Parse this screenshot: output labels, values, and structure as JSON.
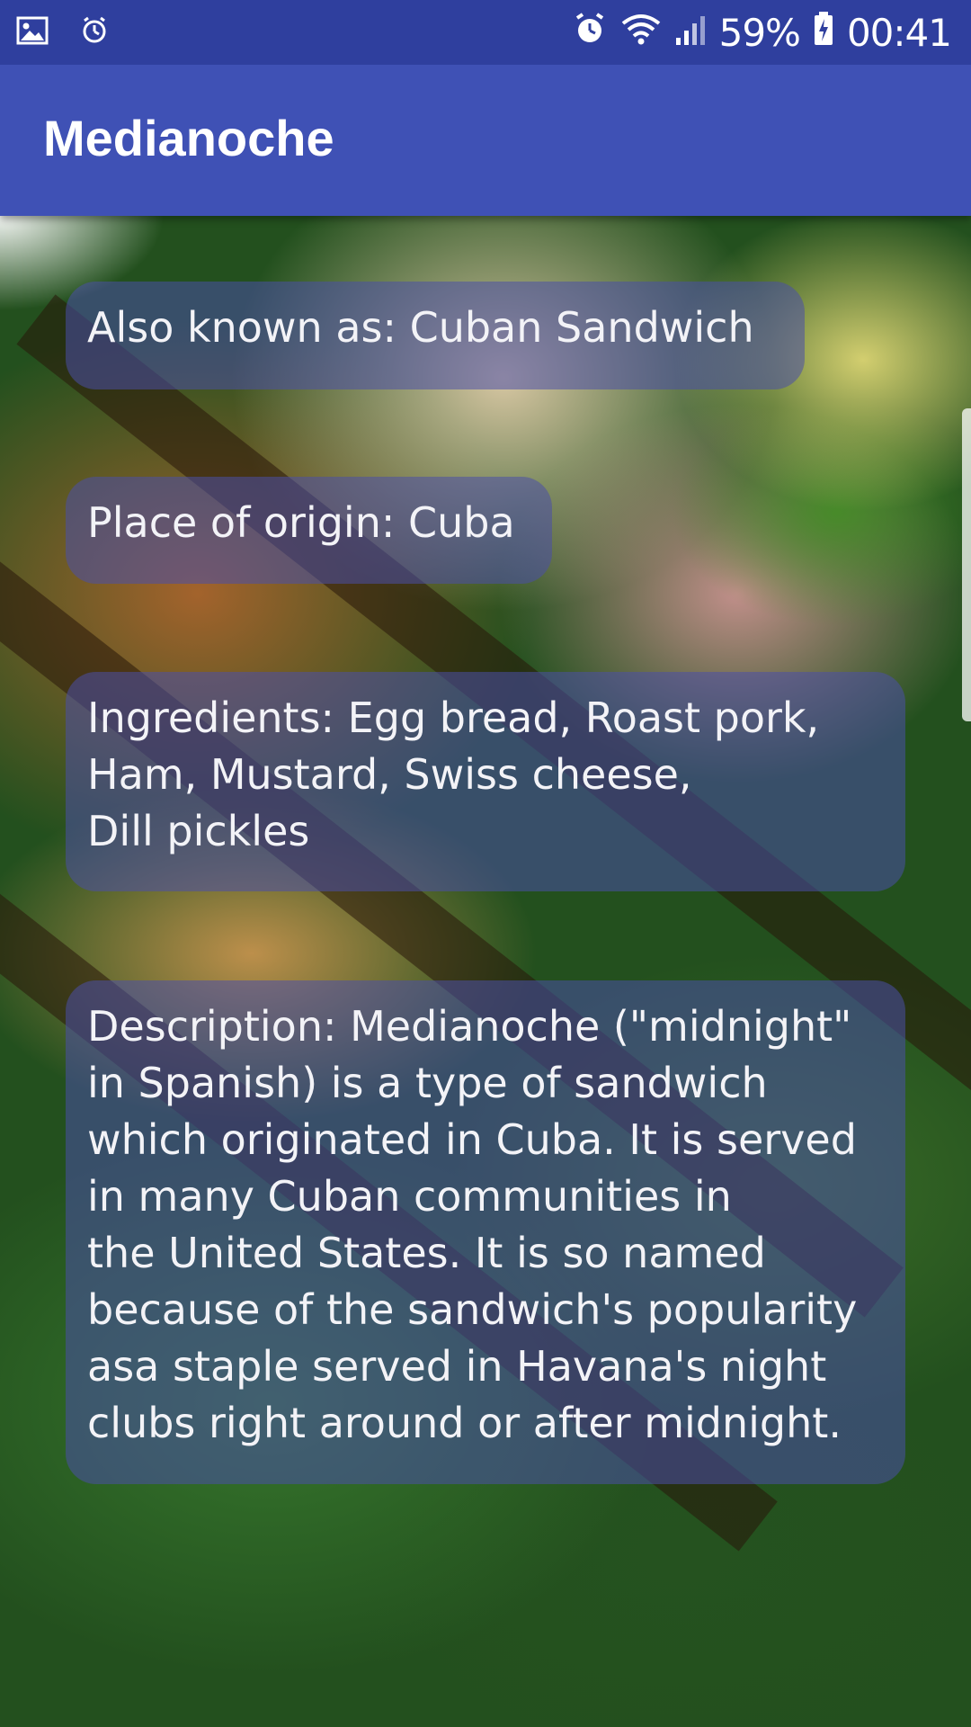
{
  "status_bar": {
    "battery": "59%",
    "time": "00:41",
    "icons": [
      "image-icon",
      "alarm-icon",
      "alarm-clock-icon",
      "wifi-icon",
      "cell-signal-icon",
      "battery-icon"
    ]
  },
  "app_bar": {
    "title": "Medianoche",
    "color": "#3F51B5"
  },
  "cards": {
    "also_known_as": "Also known as: Cuban Sandwich",
    "place_of_origin": "Place of origin: Cuba",
    "ingredients": "Ingredients: Egg bread, Roast pork,\nHam, Mustard, Swiss cheese,\nDill pickles",
    "description": "Description: Medianoche (\"midnight\"\nin Spanish) is a type of sandwich\nwhich originated in Cuba. It is served\nin many Cuban communities in\nthe United States. It is so named\nbecause of the sandwich's popularity\nasa staple served in Havana's night\nclubs right around or after midnight."
  },
  "background_image": "sandwich-photo"
}
